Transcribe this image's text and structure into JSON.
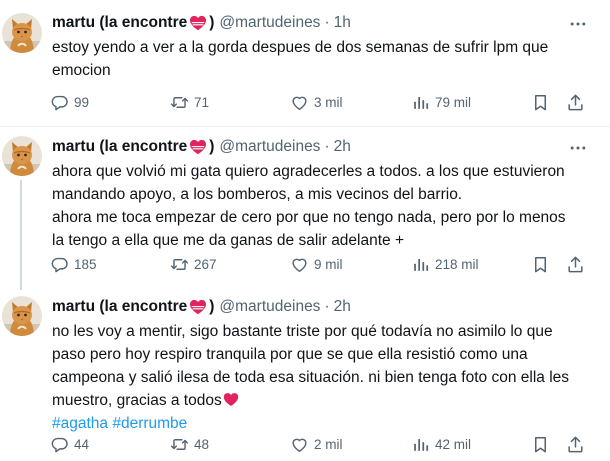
{
  "tweets": [
    {
      "author": {
        "name": "martu (la encontre",
        "handle": "@martudeines",
        "avatar": "cat-avatar"
      },
      "separator": "·",
      "time": "1h",
      "lines": [
        "estoy yendo a ver a la gorda despues de dos semanas de sufrir lpm que",
        "emocion"
      ],
      "stats": {
        "replies": "99",
        "reposts": "71",
        "likes": "3 mil",
        "views": "79 mil"
      }
    },
    {
      "author": {
        "name": "martu (la encontre",
        "handle": "@martudeines",
        "avatar": "cat-avatar"
      },
      "separator": "·",
      "time": "2h",
      "lines": [
        "ahora que volvió mi gata quiero agradecerles a todos. a los que estuvieron",
        "mandando apoyo, a los bomberos, a mis vecinos del barrio.",
        "ahora me toca empezar de cero por que no tengo nada, pero por lo menos",
        "la tengo a ella que me da ganas de salir adelante +"
      ],
      "stats": {
        "replies": "185",
        "reposts": "267",
        "likes": "9 mil",
        "views": "218 mil"
      }
    },
    {
      "author": {
        "name": "martu (la encontre",
        "handle": "@martudeines",
        "avatar": "cat-avatar"
      },
      "separator": "·",
      "time": "2h",
      "lines": [
        "no les voy a mentir, sigo bastante triste por qué todavía no asimilo lo que",
        "paso pero hoy respiro tranquila por que se que ella resistió como una",
        "campeona y salió ilesa de toda esa situación. ni bien tenga foto con ella les",
        "muestro, gracias a todos"
      ],
      "hashtags": [
        "#agatha",
        "#derrumbe"
      ],
      "stats": {
        "replies": "44",
        "reposts": "48",
        "likes": "2 mil",
        "views": "42 mil"
      }
    }
  ],
  "colors": {
    "text": "#0f1419",
    "muted": "#536471",
    "link": "#1d9bf0",
    "divider": "#eff3f4",
    "heart": "#e0245e"
  }
}
